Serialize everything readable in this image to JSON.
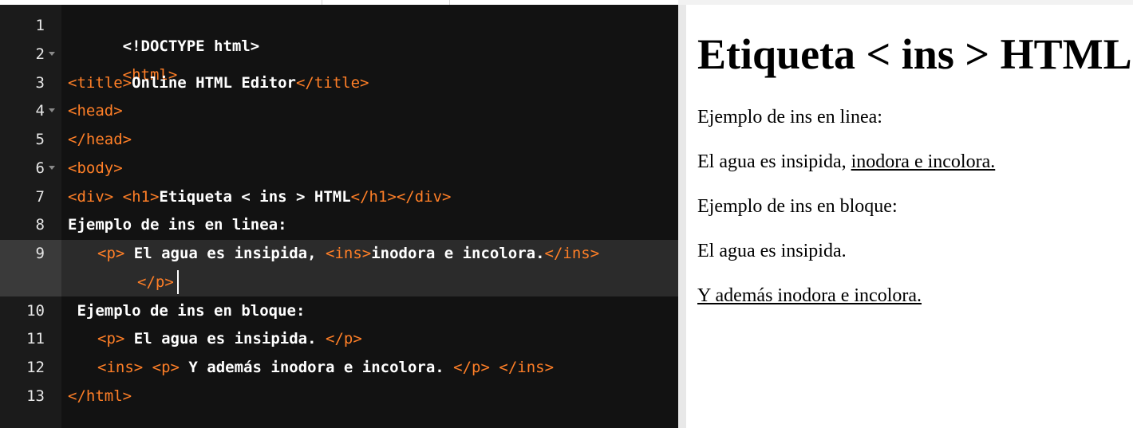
{
  "editor": {
    "line_numbers": [
      "1",
      "2",
      "3",
      "4",
      "5",
      "6",
      "7",
      "8",
      "9",
      "10",
      "11",
      "12",
      "13"
    ],
    "lines": {
      "l1": [
        "<!DOCTYPE html>"
      ],
      "l2": [
        "<html>"
      ],
      "l3": [
        "<title>",
        "Online HTML Editor",
        "</title>"
      ],
      "l4": [
        "<head>"
      ],
      "l5": [
        "</head>"
      ],
      "l6": [
        "<body>"
      ],
      "l7": [
        "<div>",
        " ",
        "<h1>",
        "Etiqueta < ins > HTML",
        "</h1>",
        "</div>"
      ],
      "l8": [
        "Ejemplo de ins en linea:"
      ],
      "l9": [
        "<p>",
        " El agua es insipida, ",
        "<ins>",
        "inodora e incolora.",
        "</ins>"
      ],
      "l9b": [
        "</p>"
      ],
      "l10": [
        " Ejemplo de ins en bloque:"
      ],
      "l11": [
        "<p>",
        " El agua es insipida. ",
        "</p>"
      ],
      "l12": [
        "<ins>",
        " ",
        "<p>",
        " Y además inodora e incolora. ",
        "</p>",
        " ",
        "</ins>"
      ],
      "l13": [
        "</html>"
      ]
    }
  },
  "preview": {
    "heading": "Etiqueta < ins > HTML",
    "p1": "Ejemplo de ins en linea:",
    "p2_plain": "El agua es insipida, ",
    "p2_ins": "inodora e incolora.",
    "p3": "Ejemplo de ins en bloque:",
    "p4": "El agua es insipida.",
    "p5_ins": "Y además inodora e incolora."
  },
  "colors": {
    "editor_bg": "#121212",
    "gutter_bg": "#1b1b1b",
    "tag": "#ff7f27",
    "text": "#ffffff",
    "active_line": "#2b2b2b"
  }
}
